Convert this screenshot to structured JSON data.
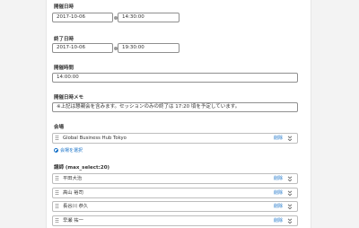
{
  "form": {
    "start": {
      "label": "開催日時",
      "date": "2017-10-06",
      "time": "14:30:00"
    },
    "end": {
      "label": "終了日時",
      "date": "2017-10-06",
      "time": "19:30:00"
    },
    "duration": {
      "label": "開催時間",
      "value": "14:00:00"
    },
    "memo": {
      "label": "開催日時メモ",
      "value": "※上記は懇親会を含みます。セッションのみの終了は 17:20 頃を予定しています。"
    },
    "venue": {
      "label": "会場",
      "item": "Global Business Hub Tokyo",
      "delete_label": "削除",
      "select_label": "会場を選択"
    },
    "speakers": {
      "label": "講師 (max_select:20)",
      "delete_label": "削除",
      "items": [
        "平田大治",
        "高山 裕司",
        "長谷川 恭久",
        "早瀬 祐一"
      ]
    }
  },
  "colors": {
    "link": "#1a73c8",
    "border": "#8f8f8f",
    "panel": "#ffffff",
    "background": "#f3f3f3"
  }
}
